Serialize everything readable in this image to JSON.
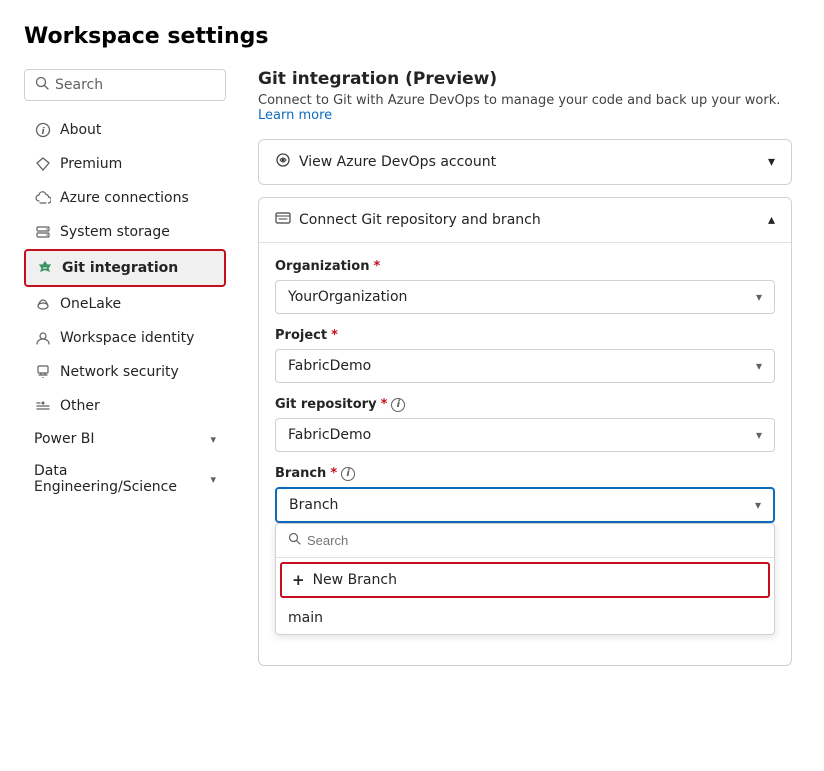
{
  "page": {
    "title": "Workspace settings"
  },
  "sidebar": {
    "search_placeholder": "Search",
    "items": [
      {
        "id": "about",
        "label": "About",
        "active": false,
        "icon": "info"
      },
      {
        "id": "premium",
        "label": "Premium",
        "active": false,
        "icon": "diamond"
      },
      {
        "id": "azure-connections",
        "label": "Azure connections",
        "active": false,
        "icon": "cloud"
      },
      {
        "id": "system-storage",
        "label": "System storage",
        "active": false,
        "icon": "storage"
      },
      {
        "id": "git-integration",
        "label": "Git integration",
        "active": true,
        "icon": "git"
      },
      {
        "id": "onelake",
        "label": "OneLake",
        "active": false,
        "icon": "onelake"
      },
      {
        "id": "workspace-identity",
        "label": "Workspace identity",
        "active": false,
        "icon": "identity"
      },
      {
        "id": "network-security",
        "label": "Network security",
        "active": false,
        "icon": "network"
      },
      {
        "id": "other",
        "label": "Other",
        "active": false,
        "icon": "other"
      }
    ],
    "sections": [
      {
        "id": "power-bi",
        "label": "Power BI",
        "expanded": false
      },
      {
        "id": "data-engineering",
        "label": "Data Engineering/Science",
        "expanded": false
      }
    ]
  },
  "main": {
    "section_title": "Git integration (Preview)",
    "section_desc": "Connect to Git with Azure DevOps to manage your code and back up your work.",
    "learn_more": "Learn more",
    "accordion1": {
      "label": "View Azure DevOps account",
      "expanded": false
    },
    "accordion2": {
      "label": "Connect Git repository and branch",
      "expanded": true,
      "fields": {
        "organization": {
          "label": "Organization",
          "required": true,
          "value": "YourOrganization"
        },
        "project": {
          "label": "Project",
          "required": true,
          "value": "FabricDemo"
        },
        "git_repository": {
          "label": "Git repository",
          "required": true,
          "has_info": true,
          "value": "FabricDemo"
        },
        "branch": {
          "label": "Branch",
          "required": true,
          "has_info": true,
          "value": "Branch",
          "dropdown_open": true,
          "search_placeholder": "Search",
          "new_branch_label": "New Branch",
          "options": [
            "main"
          ]
        }
      }
    }
  }
}
